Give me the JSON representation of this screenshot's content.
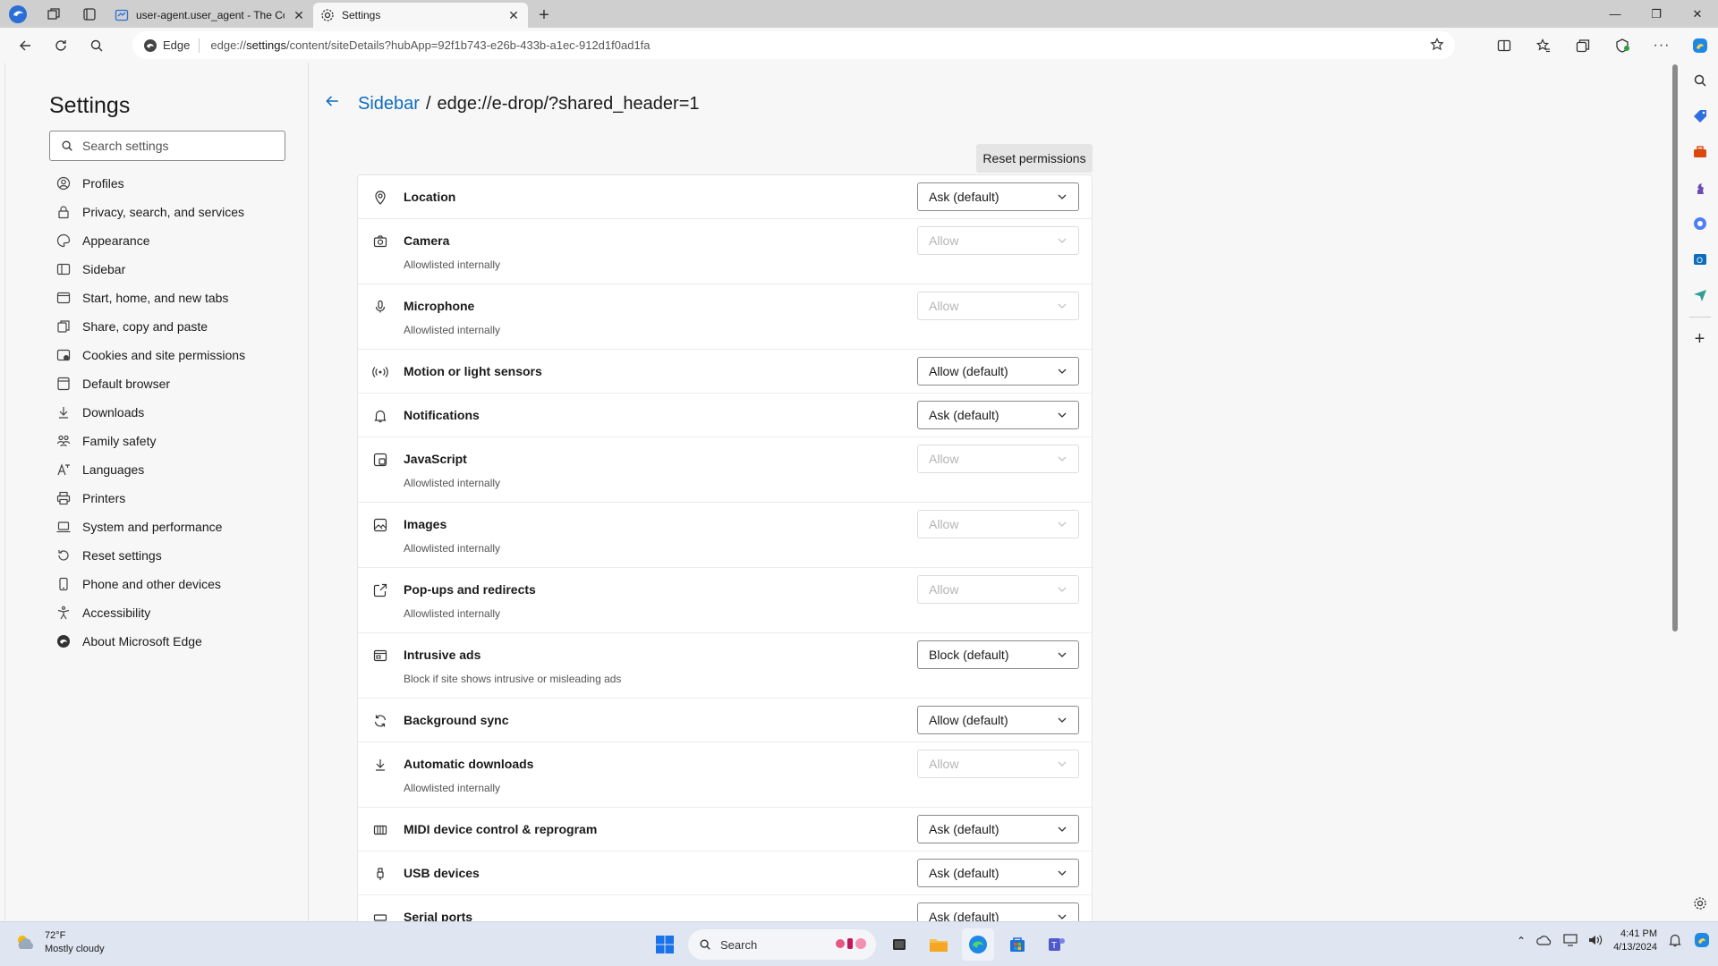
{
  "browser": {
    "tabs": [
      {
        "title": "user-agent.user_agent - The Coll",
        "icon": "collection-page-icon"
      },
      {
        "title": "Settings",
        "icon": "gear-icon"
      }
    ],
    "address": {
      "brand": "Edge",
      "url_prefix": "edge://",
      "url_host": "settings",
      "url_rest": "/content/siteDetails?hubApp=92f1b743-e26b-433b-a1ec-912d1f0ad1fa"
    }
  },
  "settings": {
    "title": "Settings",
    "search_placeholder": "Search settings",
    "nav": [
      {
        "label": "Profiles",
        "icon": "profile-icon"
      },
      {
        "label": "Privacy, search, and services",
        "icon": "lock-icon"
      },
      {
        "label": "Appearance",
        "icon": "appearance-icon"
      },
      {
        "label": "Sidebar",
        "icon": "sidebar-icon"
      },
      {
        "label": "Start, home, and new tabs",
        "icon": "home-icon"
      },
      {
        "label": "Share, copy and paste",
        "icon": "share-icon"
      },
      {
        "label": "Cookies and site permissions",
        "icon": "cookie-icon"
      },
      {
        "label": "Default browser",
        "icon": "browser-icon"
      },
      {
        "label": "Downloads",
        "icon": "download-icon"
      },
      {
        "label": "Family safety",
        "icon": "family-icon"
      },
      {
        "label": "Languages",
        "icon": "language-icon"
      },
      {
        "label": "Printers",
        "icon": "printer-icon"
      },
      {
        "label": "System and performance",
        "icon": "laptop-icon"
      },
      {
        "label": "Reset settings",
        "icon": "reset-icon"
      },
      {
        "label": "Phone and other devices",
        "icon": "phone-icon"
      },
      {
        "label": "Accessibility",
        "icon": "accessibility-icon"
      },
      {
        "label": "About Microsoft Edge",
        "icon": "edge-logo-icon"
      }
    ]
  },
  "site_details": {
    "breadcrumb_parent": "Sidebar",
    "breadcrumb_sep": "/",
    "breadcrumb_current": "edge://e-drop/?shared_header=1",
    "reset_label": "Reset permissions",
    "permissions": [
      {
        "label": "Location",
        "value": "Ask (default)",
        "desc": "",
        "disabled": false,
        "icon": "location-icon"
      },
      {
        "label": "Camera",
        "value": "Allow",
        "desc": "Allowlisted internally",
        "disabled": true,
        "icon": "camera-icon"
      },
      {
        "label": "Microphone",
        "value": "Allow",
        "desc": "Allowlisted internally",
        "disabled": true,
        "icon": "microphone-icon"
      },
      {
        "label": "Motion or light sensors",
        "value": "Allow (default)",
        "desc": "",
        "disabled": false,
        "icon": "sensor-icon"
      },
      {
        "label": "Notifications",
        "value": "Ask (default)",
        "desc": "",
        "disabled": false,
        "icon": "bell-icon"
      },
      {
        "label": "JavaScript",
        "value": "Allow",
        "desc": "Allowlisted internally",
        "disabled": true,
        "icon": "javascript-icon"
      },
      {
        "label": "Images",
        "value": "Allow",
        "desc": "Allowlisted internally",
        "disabled": true,
        "icon": "image-icon"
      },
      {
        "label": "Pop-ups and redirects",
        "value": "Allow",
        "desc": "Allowlisted internally",
        "disabled": true,
        "icon": "popup-icon"
      },
      {
        "label": "Intrusive ads",
        "value": "Block (default)",
        "desc": "Block if site shows intrusive or misleading ads",
        "disabled": false,
        "icon": "ads-icon"
      },
      {
        "label": "Background sync",
        "value": "Allow (default)",
        "desc": "",
        "disabled": false,
        "icon": "sync-icon"
      },
      {
        "label": "Automatic downloads",
        "value": "Allow",
        "desc": "Allowlisted internally",
        "disabled": true,
        "icon": "download-icon"
      },
      {
        "label": "MIDI device control & reprogram",
        "value": "Ask (default)",
        "desc": "",
        "disabled": false,
        "icon": "midi-icon"
      },
      {
        "label": "USB devices",
        "value": "Ask (default)",
        "desc": "",
        "disabled": false,
        "icon": "usb-icon"
      },
      {
        "label": "Serial ports",
        "value": "Ask (default)",
        "desc": "",
        "disabled": false,
        "icon": "serial-icon"
      }
    ]
  },
  "taskbar": {
    "temperature": "72°F",
    "condition": "Mostly cloudy",
    "search_label": "Search",
    "time": "4:41 PM",
    "date": "4/13/2024"
  },
  "colors": {
    "accent": "#0f6cbd",
    "tabstrip": "#cfcfcf",
    "taskbar": "#dfe6f1"
  }
}
